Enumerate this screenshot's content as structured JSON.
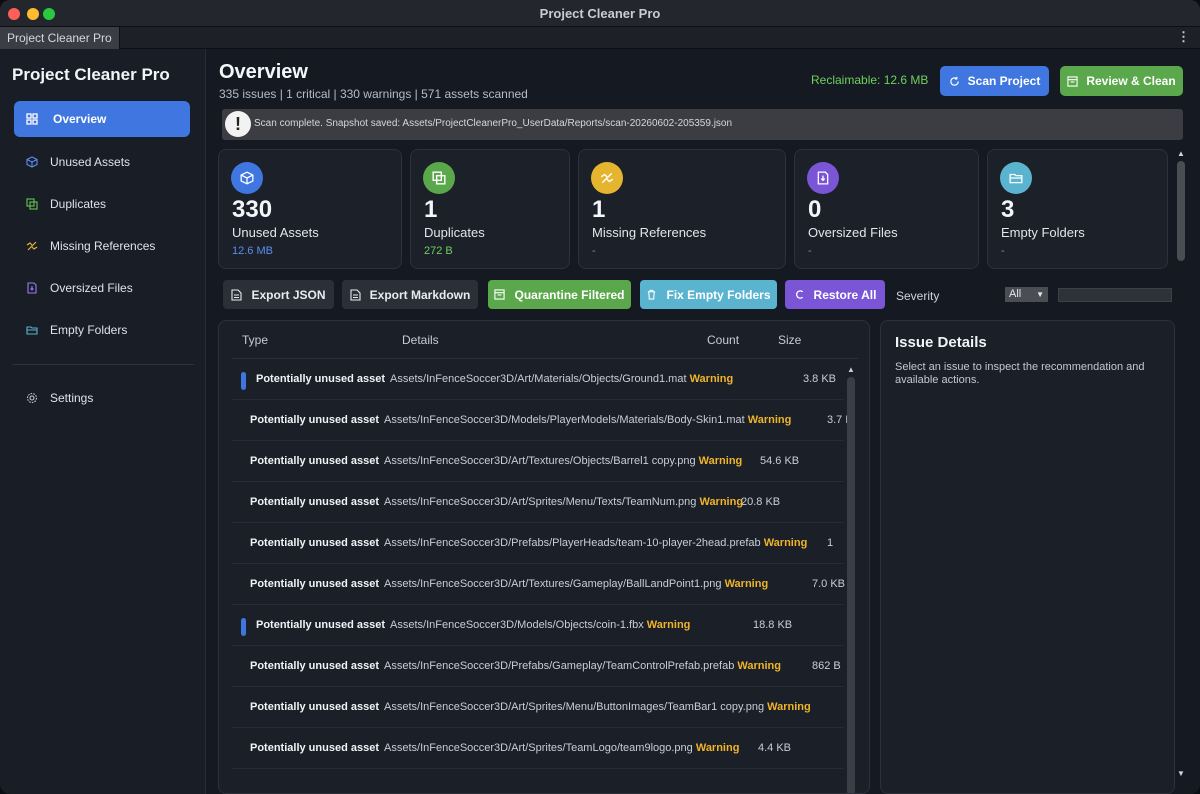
{
  "window": {
    "title": "Project Cleaner Pro",
    "tab": "Project Cleaner Pro",
    "menu_icon": "kebab-menu-icon"
  },
  "sidebar": {
    "brand": "Project Cleaner Pro",
    "items": [
      {
        "label": "Overview",
        "icon": "grid-icon",
        "active": true
      },
      {
        "label": "Unused Assets",
        "icon": "cube-icon"
      },
      {
        "label": "Duplicates",
        "icon": "copy-icon"
      },
      {
        "label": "Missing References",
        "icon": "broken-link-icon"
      },
      {
        "label": "Oversized Files",
        "icon": "file-icon"
      },
      {
        "label": "Empty Folders",
        "icon": "folder-icon"
      }
    ],
    "settings": {
      "label": "Settings",
      "icon": "gear-icon"
    }
  },
  "header": {
    "title": "Overview",
    "subtitle": "335 issues | 1 critical | 330 warnings | 571 assets scanned",
    "reclaimable": "Reclaimable: 12.6 MB",
    "scan_button": "Scan Project",
    "review_button": "Review & Clean"
  },
  "notice": {
    "text": "Scan complete. Snapshot saved: Assets/ProjectCleanerPro_UserData/Reports/scan-20260602-205359.json"
  },
  "cards": [
    {
      "value": "330",
      "label": "Unused Assets",
      "sub": "12.6 MB",
      "color": "#3f76e0",
      "icon": "cube-icon"
    },
    {
      "value": "1",
      "label": "Duplicates",
      "sub": "272 B",
      "color": "#5aa84b",
      "icon": "copy-icon"
    },
    {
      "value": "1",
      "label": "Missing References",
      "sub": "-",
      "color": "#e6b530",
      "icon": "broken-link-icon"
    },
    {
      "value": "0",
      "label": "Oversized Files",
      "sub": "-",
      "color": "#7a55d6",
      "icon": "file-icon"
    },
    {
      "value": "3",
      "label": "Empty Folders",
      "sub": "-",
      "color": "#5ab3cf",
      "icon": "folder-icon"
    }
  ],
  "actions": {
    "export_json": "Export JSON",
    "export_markdown": "Export Markdown",
    "quarantine": "Quarantine Filtered",
    "fix_empty": "Fix Empty Folders",
    "restore": "Restore All",
    "severity_label": "Severity",
    "severity_value": "All"
  },
  "table": {
    "columns": [
      "Type",
      "Details",
      "Count",
      "Size"
    ],
    "rows": [
      {
        "type": "Potentially unused asset",
        "path": "Assets/InFenceSoccer3D/Art/Materials/Objects/Ground1.mat",
        "severity": "Warning",
        "size": "3.8 KB",
        "marked": true
      },
      {
        "type": "Potentially unused asset",
        "path": "Assets/InFenceSoccer3D/Models/PlayerModels/Materials/Body-Skin1.mat",
        "severity": "Warning",
        "size": "3.7 K",
        "marked": false
      },
      {
        "type": "Potentially unused asset",
        "path": "Assets/InFenceSoccer3D/Art/Textures/Objects/Barrel1 copy.png",
        "severity": "Warning",
        "size": "54.6 KB",
        "marked": false
      },
      {
        "type": "Potentially unused asset",
        "path": "Assets/InFenceSoccer3D/Art/Sprites/Menu/Texts/TeamNum.png",
        "severity": "Warning",
        "size": "20.8 KB",
        "marked": false
      },
      {
        "type": "Potentially unused asset",
        "path": "Assets/InFenceSoccer3D/Prefabs/PlayerHeads/team-10-player-2head.prefab",
        "severity": "Warning",
        "size": "1",
        "marked": false
      },
      {
        "type": "Potentially unused asset",
        "path": "Assets/InFenceSoccer3D/Art/Textures/Gameplay/BallLandPoint1.png",
        "severity": "Warning",
        "size": "7.0 KB",
        "marked": false
      },
      {
        "type": "Potentially unused asset",
        "path": "Assets/InFenceSoccer3D/Models/Objects/coin-1.fbx",
        "severity": "Warning",
        "size": "18.8 KB",
        "marked": true
      },
      {
        "type": "Potentially unused asset",
        "path": "Assets/InFenceSoccer3D/Prefabs/Gameplay/TeamControlPrefab.prefab",
        "severity": "Warning",
        "size": "862 B",
        "marked": false
      },
      {
        "type": "Potentially unused asset",
        "path": "Assets/InFenceSoccer3D/Art/Sprites/Menu/ButtonImages/TeamBar1 copy.png",
        "severity": "Warning",
        "size": "",
        "marked": false
      },
      {
        "type": "Potentially unused asset",
        "path": "Assets/InFenceSoccer3D/Art/Sprites/TeamLogo/team9logo.png",
        "severity": "Warning",
        "size": "4.4 KB",
        "marked": false
      }
    ]
  },
  "details": {
    "title": "Issue Details",
    "text": "Select an issue to inspect the recommendation and available actions."
  }
}
